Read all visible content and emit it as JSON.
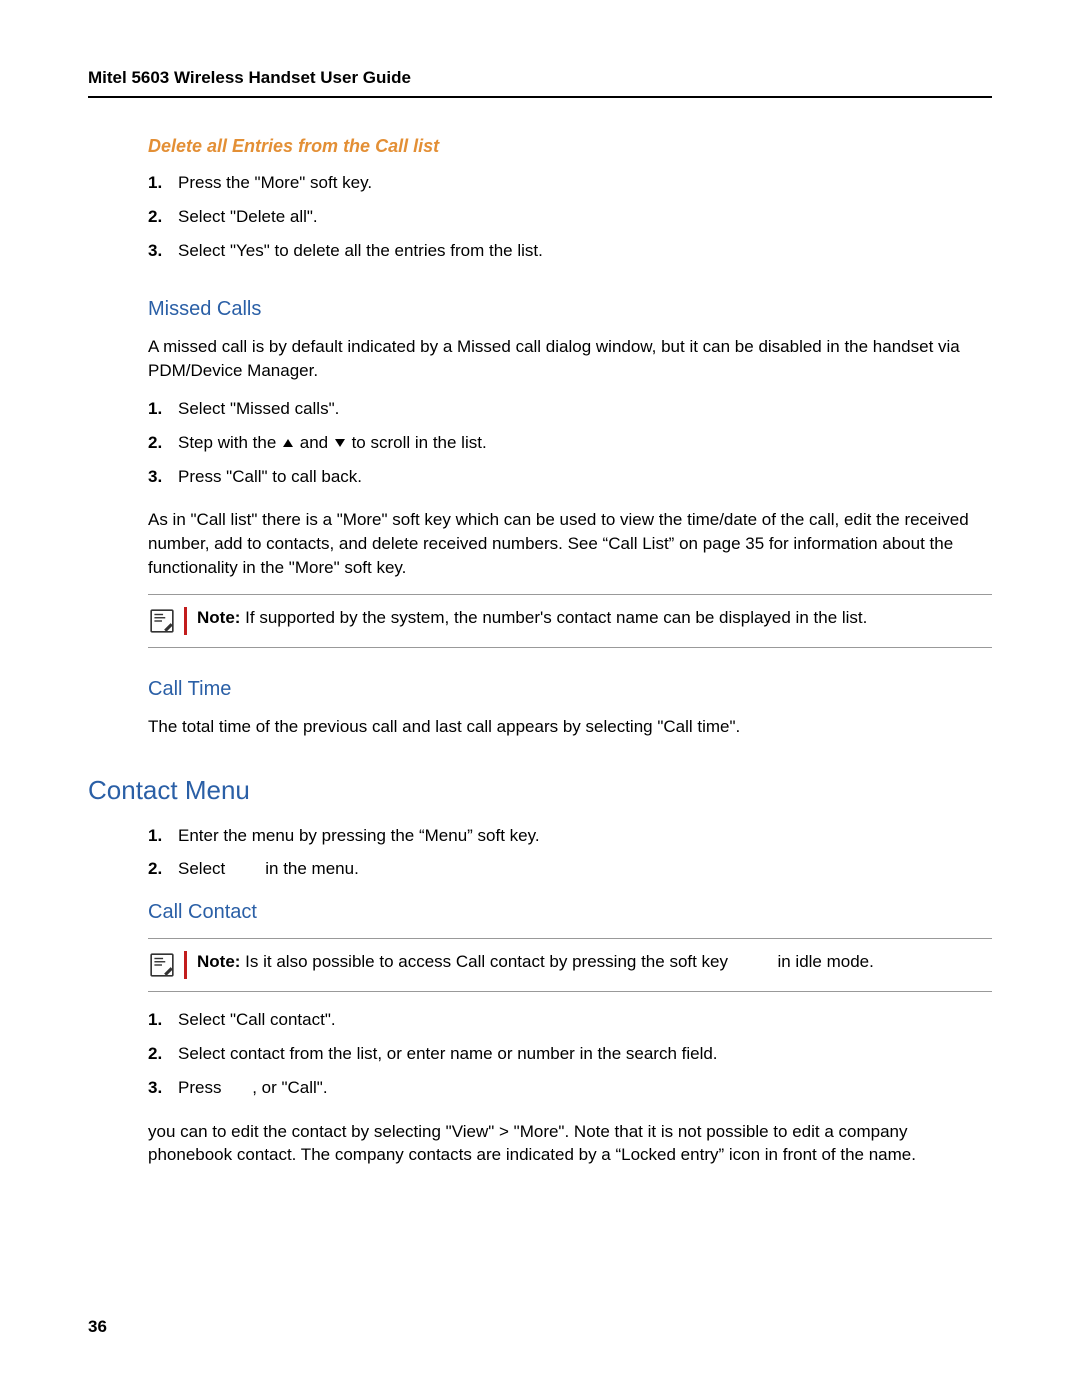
{
  "header": "Mitel 5603 Wireless Handset User Guide",
  "pageNumber": "36",
  "sec1": {
    "heading": "Delete all Entries from the Call list",
    "items": [
      "Press the \"More\" soft key.",
      "Select \"Delete all\".",
      "Select \"Yes\" to delete all the entries from the list."
    ]
  },
  "sec2": {
    "heading": "Missed Calls",
    "intro": "A missed call is by default indicated by a Missed call dialog window, but it can be disabled in the handset via PDM/Device Manager.",
    "items": {
      "i1": "Select \"Missed calls\".",
      "i2a": "Step with the ",
      "i2b": " and ",
      "i2c": " to scroll in the list.",
      "i3": "Press \"Call\" to call back."
    },
    "after": "As in \"Call list\" there is a \"More\" soft key which can be used to view the time/date of the call, edit the received number, add to contacts, and delete received numbers. See “Call List” on page 35 for information about the functionality in the \"More\" soft key.",
    "noteLabel": "Note:",
    "noteText": " If supported by the system, the number's contact name can be displayed in the list."
  },
  "sec3": {
    "heading": "Call Time",
    "text": "The total time of the previous call and last call appears by selecting \"Call time\"."
  },
  "sec4": {
    "heading": "Contact Menu",
    "items": {
      "i1": "Enter the menu by pressing the “Menu” soft key.",
      "i2a": "Select",
      "i2b": "in the menu."
    }
  },
  "sec5": {
    "heading": "Call Contact",
    "noteLabel": "Note:",
    "noteTextA": " Is it also possible to access Call contact by pressing the soft key ",
    "noteTextB": " in idle mode.",
    "items": {
      "i1": "Select \"Call contact\".",
      "i2": "Select contact from the list, or enter name or number in the search field.",
      "i3a": "Press ",
      "i3b": ", or \"Call\"."
    },
    "after": "you can to edit the contact by selecting \"View\" > \"More\". Note that it is not possible to edit a company phonebook contact. The company contacts are indicated by a “Locked entry” icon in front of the name."
  }
}
